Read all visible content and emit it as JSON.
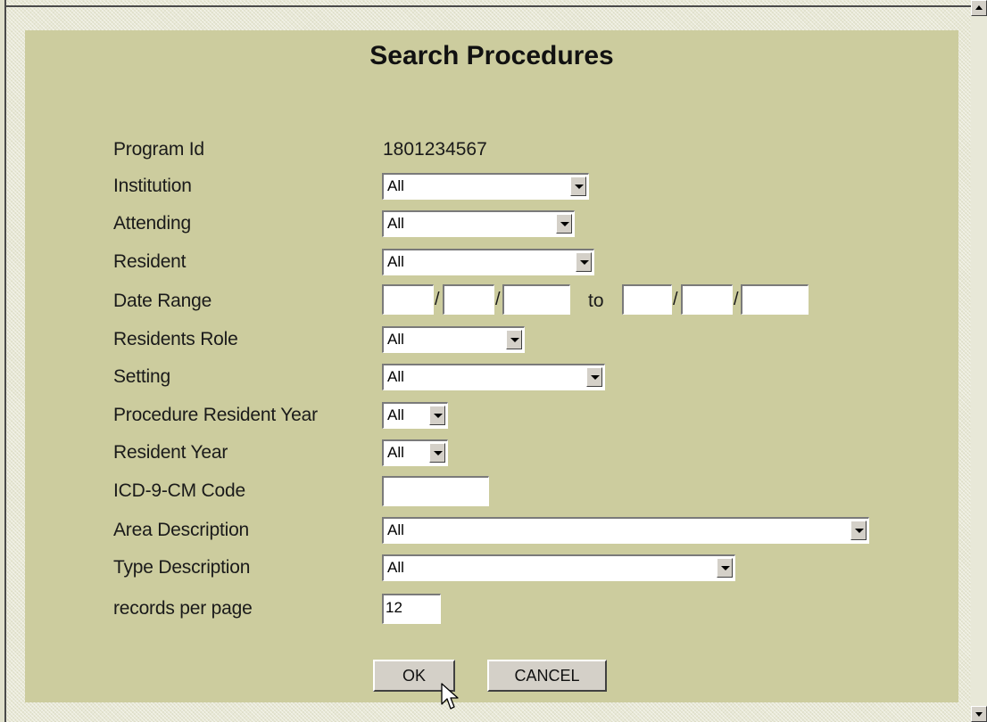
{
  "title": "Search Procedures",
  "fields": {
    "program_id": {
      "label": "Program Id",
      "value": "1801234567"
    },
    "institution": {
      "label": "Institution",
      "value": "All"
    },
    "attending": {
      "label": "Attending",
      "value": "All"
    },
    "resident": {
      "label": "Resident",
      "value": "All"
    },
    "date_range": {
      "label": "Date Range",
      "sep": "/",
      "to": "to"
    },
    "residents_role": {
      "label": "Residents Role",
      "value": "All"
    },
    "setting": {
      "label": "Setting",
      "value": "All"
    },
    "procedure_resident_year": {
      "label": "Procedure Resident Year",
      "value": "All"
    },
    "resident_year": {
      "label": "Resident Year",
      "value": "All"
    },
    "icd9": {
      "label": "ICD-9-CM Code",
      "value": ""
    },
    "area_description": {
      "label": "Area Description",
      "value": "All"
    },
    "type_description": {
      "label": "Type Description",
      "value": "All"
    },
    "records_per_page": {
      "label": "records per page",
      "value": "12"
    }
  },
  "buttons": {
    "ok": "OK",
    "cancel": "CANCEL"
  }
}
